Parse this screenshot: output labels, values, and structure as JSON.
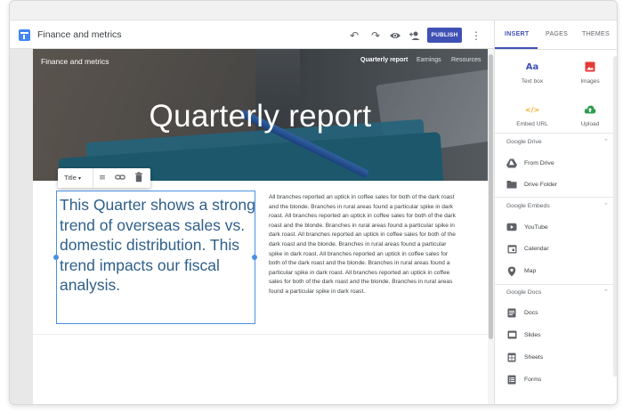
{
  "app": {
    "title": "Finance and metrics",
    "publish_label": "PUBLISH",
    "icons": [
      "undo-icon",
      "redo-icon",
      "preview-eye-icon",
      "share-person-add-icon",
      "more-vert-icon"
    ]
  },
  "site": {
    "title": "Finance and metrics",
    "nav": [
      "Quarterly report",
      "Earnings",
      "Resources"
    ],
    "active_nav": "Quarterly report",
    "hero_heading": "Quarterly report"
  },
  "block_toolbar": {
    "style_label": "Title",
    "icons": [
      "align-icon",
      "link-icon",
      "delete-icon"
    ]
  },
  "content": {
    "textbox": "This Quarter shows a strong trend of overseas sales vs. domestic distribution.  This trend impacts our fiscal analysis.",
    "paragraph": "All branches reported an uptick in coffee sales for both of the dark roast and the blonde.  Branches in rural areas found a particular spike in dark roast. All branches reported an uptick in coffee sales for both of the dark roast and the blonde.  Branches in rural areas found a particular spike in dark roast.  All branches reported an uptick in coffee sales for both of the dark roast and the blonde.  Branches in rural areas found a particular spike in dark roast.  All branches reported an uptick in coffee sales for both of the dark roast and the blonde.  Branches in rural areas found a particular spike in dark roast.  All branches reported an uptick in coffee sales for both of the dark roast and the blonde.  Branches in rural areas found a particular spike in dark roast."
  },
  "sidebar": {
    "tabs": [
      "INSERT",
      "PAGES",
      "THEMES"
    ],
    "active_tab": "INSERT",
    "tiles": [
      {
        "label": "Text box",
        "glyph": "Aa",
        "color": "#3f51b5"
      },
      {
        "label": "Images",
        "glyph": "▣",
        "color": "#e53935"
      },
      {
        "label": "Embed URL",
        "glyph": "</>",
        "color": "#f9a825"
      },
      {
        "label": "Upload",
        "glyph": "☁",
        "color": "#2e9b4e"
      }
    ],
    "sections": [
      {
        "header": "Google Drive",
        "items": [
          {
            "label": "From Drive",
            "icon": "drive-icon"
          },
          {
            "label": "Drive Folder",
            "icon": "drive-folder-icon"
          }
        ]
      },
      {
        "header": "Google Embeds",
        "items": [
          {
            "label": "YouTube",
            "icon": "youtube-icon"
          },
          {
            "label": "Calendar",
            "icon": "calendar-icon"
          },
          {
            "label": "Map",
            "icon": "map-pin-icon"
          }
        ]
      },
      {
        "header": "Google Docs",
        "items": [
          {
            "label": "Docs",
            "icon": "docs-icon"
          },
          {
            "label": "Slides",
            "icon": "slides-icon"
          },
          {
            "label": "Sheets",
            "icon": "sheets-icon"
          },
          {
            "label": "Forms",
            "icon": "forms-icon"
          }
        ]
      }
    ]
  }
}
